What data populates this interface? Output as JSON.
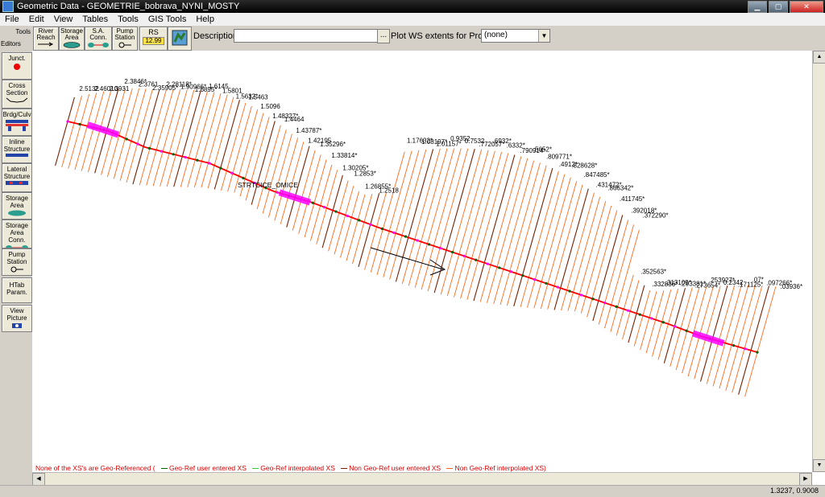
{
  "window": {
    "title": "Geometric Data - GEOMETRIE_bobrava_NYNI_MOSTY"
  },
  "menu": [
    "File",
    "Edit",
    "View",
    "Tables",
    "Tools",
    "GIS Tools",
    "Help"
  ],
  "toolbar": {
    "tools_label": "Tools",
    "editors_label": "Editors",
    "river_reach": "River Reach",
    "storage_area": "Storage Area",
    "sa_conn": "S.A. Conn.",
    "pump_station": "Pump Station",
    "rs": "RS",
    "rs_badge": "12.99",
    "description_label": "Description :",
    "description_value": "",
    "browse_label": "...",
    "plot_ws_label": "Plot WS extents for Profile:",
    "profile_value": "(none)"
  },
  "editors": [
    {
      "label": "Junct."
    },
    {
      "label": "Cross Section"
    },
    {
      "label": "Brdg/Culv"
    },
    {
      "label": "Inline Structure"
    },
    {
      "label": "Lateral Structure"
    },
    {
      "label": "Storage Area"
    },
    {
      "label": "Storage Area Conn."
    },
    {
      "label": "Pump Station"
    },
    {
      "label": "HTab Param."
    },
    {
      "label": "View Picture"
    }
  ],
  "plot": {
    "node_label": "STRTCICE_OMICE",
    "station_labels": [
      "2.5132",
      "2.46010",
      "2.3931",
      "2.3846*",
      "2.3761",
      "2.35905*",
      "2.28118*",
      "1.90966*",
      "1.6895*",
      "1.6145",
      "1.5801",
      "1.5632*",
      "1.5463",
      "1.5096",
      "1.48327*",
      "1.4464",
      "1.43787*",
      "1.42195",
      "1.35296*",
      "1.33814*",
      "1.30205*",
      "1.2853*",
      "1.26855*",
      "1.2518",
      "1.17632*",
      "1.08197*",
      "1.01157*",
      "0.9352",
      "0.7532",
      ".772057*",
      ".6932*",
      ".6332*",
      ".790914*",
      ".5652*",
      ".809771*",
      ".4912*",
      ".828628*",
      ".847485*",
      ".431472*",
      ".866342*",
      ".411745*",
      ".392018*",
      ".372290*",
      ".352563*",
      ".332836*",
      ".313109*",
      ".293381*",
      ".273654*",
      ".253927*",
      "0.2342",
      ".171125*",
      ".07*",
      ".097266*",
      ".03936*"
    ],
    "colors": {
      "geo_user": "#006400",
      "geo_interp": "#33cc33",
      "nongeo_user": "#7a1f00",
      "nongeo_interp": "#ff6a1a",
      "river": "#ff0000",
      "bridge": "#ff00ff"
    }
  },
  "legend": {
    "none_text": "None of the XS's are Geo-Referenced (",
    "geo_user": "Geo-Ref user entered XS",
    "geo_interp": "Geo-Ref interpolated XS",
    "nongeo_user": "Non Geo-Ref user entered XS",
    "nongeo_interp": "Non Geo-Ref interpolated XS)"
  },
  "status": {
    "coordinates": "1.3237, 0.9008"
  }
}
